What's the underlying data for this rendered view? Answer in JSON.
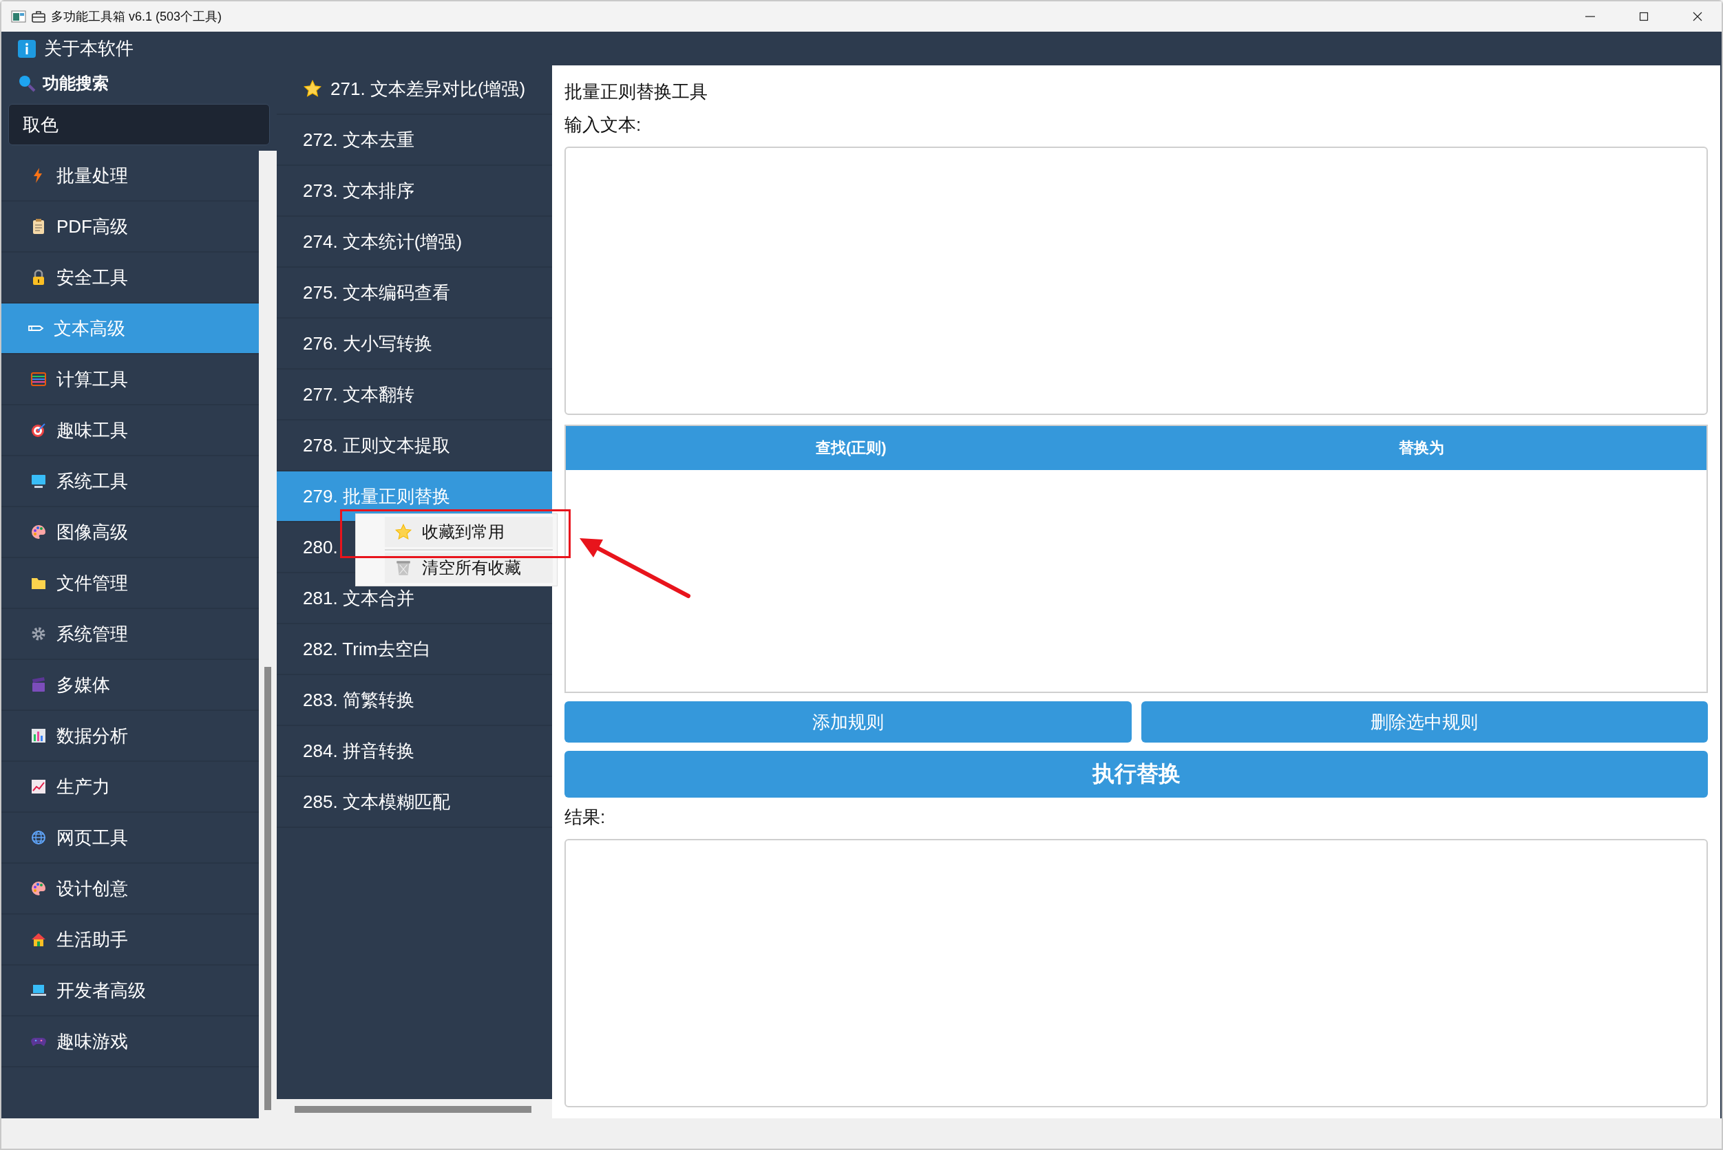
{
  "window": {
    "title": "多功能工具箱 v6.1 (503个工具)"
  },
  "about": {
    "label": "关于本软件"
  },
  "search": {
    "label": "功能搜索",
    "value": "取色"
  },
  "categories": [
    {
      "label": "批量处理",
      "selected": false
    },
    {
      "label": "PDF高级",
      "selected": false
    },
    {
      "label": "安全工具",
      "selected": false
    },
    {
      "label": "文本高级",
      "selected": true
    },
    {
      "label": "计算工具",
      "selected": false
    },
    {
      "label": "趣味工具",
      "selected": false
    },
    {
      "label": "系统工具",
      "selected": false
    },
    {
      "label": "图像高级",
      "selected": false
    },
    {
      "label": "文件管理",
      "selected": false
    },
    {
      "label": "系统管理",
      "selected": false
    },
    {
      "label": "多媒体",
      "selected": false
    },
    {
      "label": "数据分析",
      "selected": false
    },
    {
      "label": "生产力",
      "selected": false
    },
    {
      "label": "网页工具",
      "selected": false
    },
    {
      "label": "设计创意",
      "selected": false
    },
    {
      "label": "生活助手",
      "selected": false
    },
    {
      "label": "开发者高级",
      "selected": false
    },
    {
      "label": "趣味游戏",
      "selected": false
    }
  ],
  "tools": [
    {
      "label": "271. 文本差异对比(增强)",
      "favorite": true,
      "selected": false
    },
    {
      "label": "272. 文本去重",
      "favorite": false,
      "selected": false
    },
    {
      "label": "273. 文本排序",
      "favorite": false,
      "selected": false
    },
    {
      "label": "274. 文本统计(增强)",
      "favorite": false,
      "selected": false
    },
    {
      "label": "275. 文本编码查看",
      "favorite": false,
      "selected": false
    },
    {
      "label": "276. 大小写转换",
      "favorite": false,
      "selected": false
    },
    {
      "label": "277. 文本翻转",
      "favorite": false,
      "selected": false
    },
    {
      "label": "278. 正则文本提取",
      "favorite": false,
      "selected": false
    },
    {
      "label": "279. 批量正则替换",
      "favorite": false,
      "selected": true
    },
    {
      "label": "280.",
      "favorite": false,
      "selected": false
    },
    {
      "label": "281. 文本合并",
      "favorite": false,
      "selected": false
    },
    {
      "label": "282. Trim去空白",
      "favorite": false,
      "selected": false
    },
    {
      "label": "283. 简繁转换",
      "favorite": false,
      "selected": false
    },
    {
      "label": "284. 拼音转换",
      "favorite": false,
      "selected": false
    },
    {
      "label": "285. 文本模糊匹配",
      "favorite": false,
      "selected": false
    }
  ],
  "context_menu": {
    "items": [
      {
        "label": "收藏到常用"
      },
      {
        "label": "清空所有收藏"
      }
    ]
  },
  "panel": {
    "title": "批量正则替换工具",
    "input_label": "输入文本:",
    "rules_table": {
      "columns": [
        "查找(正则)",
        "替换为"
      ]
    },
    "buttons": [
      "添加规则",
      "删除选中规则"
    ],
    "run_button": "执行替换",
    "result_label": "结果:"
  }
}
